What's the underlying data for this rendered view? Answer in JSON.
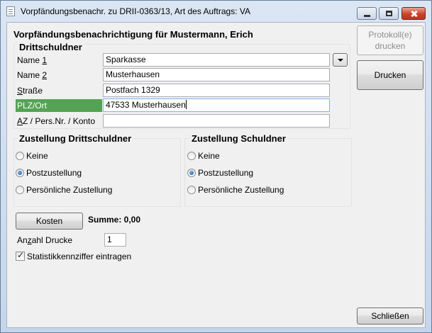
{
  "window": {
    "title": "Vorpfändungsbenachr. zu DRII-0363/13, Art des Auftrags: VA"
  },
  "form": {
    "heading": "Vorpfändungsbenachrichtigung für Mustermann, Erich",
    "drittschuldner_heading": "Drittschuldner",
    "fields": {
      "name1": {
        "label_pre": "Name ",
        "label_acc": "1",
        "value": "Sparkasse"
      },
      "name2": {
        "label_pre": "Name ",
        "label_acc": "2",
        "value": "Musterhausen"
      },
      "strasse": {
        "label_acc": "S",
        "label_post": "traße",
        "value": "Postfach 1329"
      },
      "plzort": {
        "label": "PLZ/Ort",
        "value": "47533 Musterhausen"
      },
      "az": {
        "label_acc": "A",
        "label_post": "Z / Pers.Nr. / Konto",
        "value": ""
      }
    },
    "zustellung_dritt": {
      "heading": "Zustellung Drittschuldner",
      "options": [
        "Keine",
        "Postzustellung",
        "Persönliche Zustellung"
      ],
      "selected": "Postzustellung"
    },
    "zustellung_schuldner": {
      "heading": "Zustellung Schuldner",
      "options": [
        "Keine",
        "Postzustellung",
        "Persönliche Zustellung"
      ],
      "selected": "Postzustellung"
    },
    "kosten_button": "Kosten",
    "summe": "Summe: 0,00",
    "anzahl": {
      "label_pre": "An",
      "label_acc": "z",
      "label_post": "ahl Drucke",
      "value": "1"
    },
    "statistik": {
      "label": "Statistikkennziffer eintragen",
      "checked": true
    }
  },
  "buttons": {
    "protokoll": "Protokoll(e) drucken",
    "drucken": "Drucken",
    "schliessen": "Schließen"
  },
  "icons": {
    "title_icon": "document-icon",
    "dropdown": "chevron-down-icon"
  }
}
